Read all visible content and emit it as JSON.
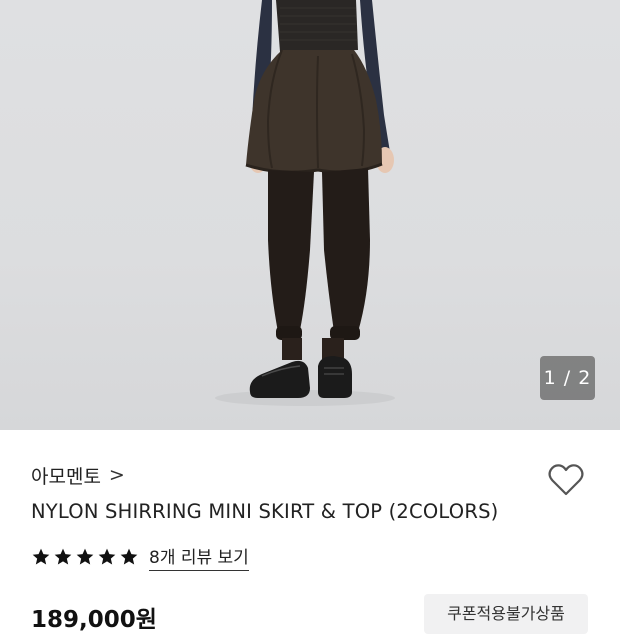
{
  "gallery": {
    "page_indicator": "1 / 2",
    "current_index": 1,
    "total": 2
  },
  "product": {
    "brand": "아모멘토",
    "brand_chevron": ">",
    "title": "NYLON SHIRRING MINI SKIRT & TOP (2COLORS)",
    "rating_stars": 5,
    "review_link": "8개 리뷰 보기",
    "price": "189,000원",
    "coupon_badge": "쿠폰적용불가상품"
  },
  "icons": {
    "like": "heart-outline-icon",
    "star": "star-filled-icon",
    "chevron": "chevron-right-icon"
  },
  "colors": {
    "star": "#111111",
    "heart_stroke": "#555555",
    "indicator_bg": "#5f5f5f",
    "coupon_bg": "#f1f1f2"
  }
}
